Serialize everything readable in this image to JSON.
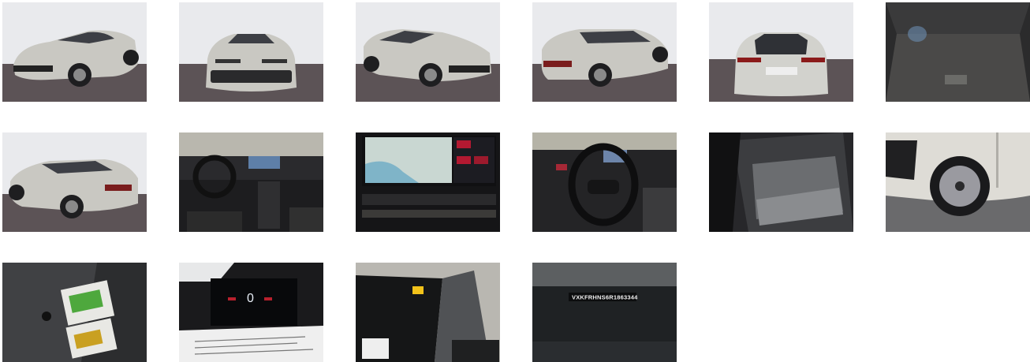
{
  "gallery": {
    "photos": [
      {
        "subject": "front-three-quarter-left-exterior"
      },
      {
        "subject": "front-exterior"
      },
      {
        "subject": "front-three-quarter-right-exterior"
      },
      {
        "subject": "rear-three-quarter-right-exterior"
      },
      {
        "subject": "rear-exterior"
      },
      {
        "subject": "cargo-area"
      },
      {
        "subject": "rear-three-quarter-left-exterior"
      },
      {
        "subject": "dashboard-interior"
      },
      {
        "subject": "infotainment-screen"
      },
      {
        "subject": "steering-wheel-interior"
      },
      {
        "subject": "rear-seats"
      },
      {
        "subject": "wheel-closeup"
      },
      {
        "subject": "manuals-on-seat"
      },
      {
        "subject": "instrument-cluster"
      },
      {
        "subject": "windshield-sticker"
      },
      {
        "subject": "vin-plate"
      }
    ],
    "cluster_speed": "0",
    "vin": "VXKFRHNS6R1863344"
  },
  "colors": {
    "background": "#ffffff",
    "studio_wall": "#e9eaed",
    "studio_floor": "#5c5356",
    "car_body": "#c9c8c2",
    "dark_interior": "#1b1b1d"
  }
}
